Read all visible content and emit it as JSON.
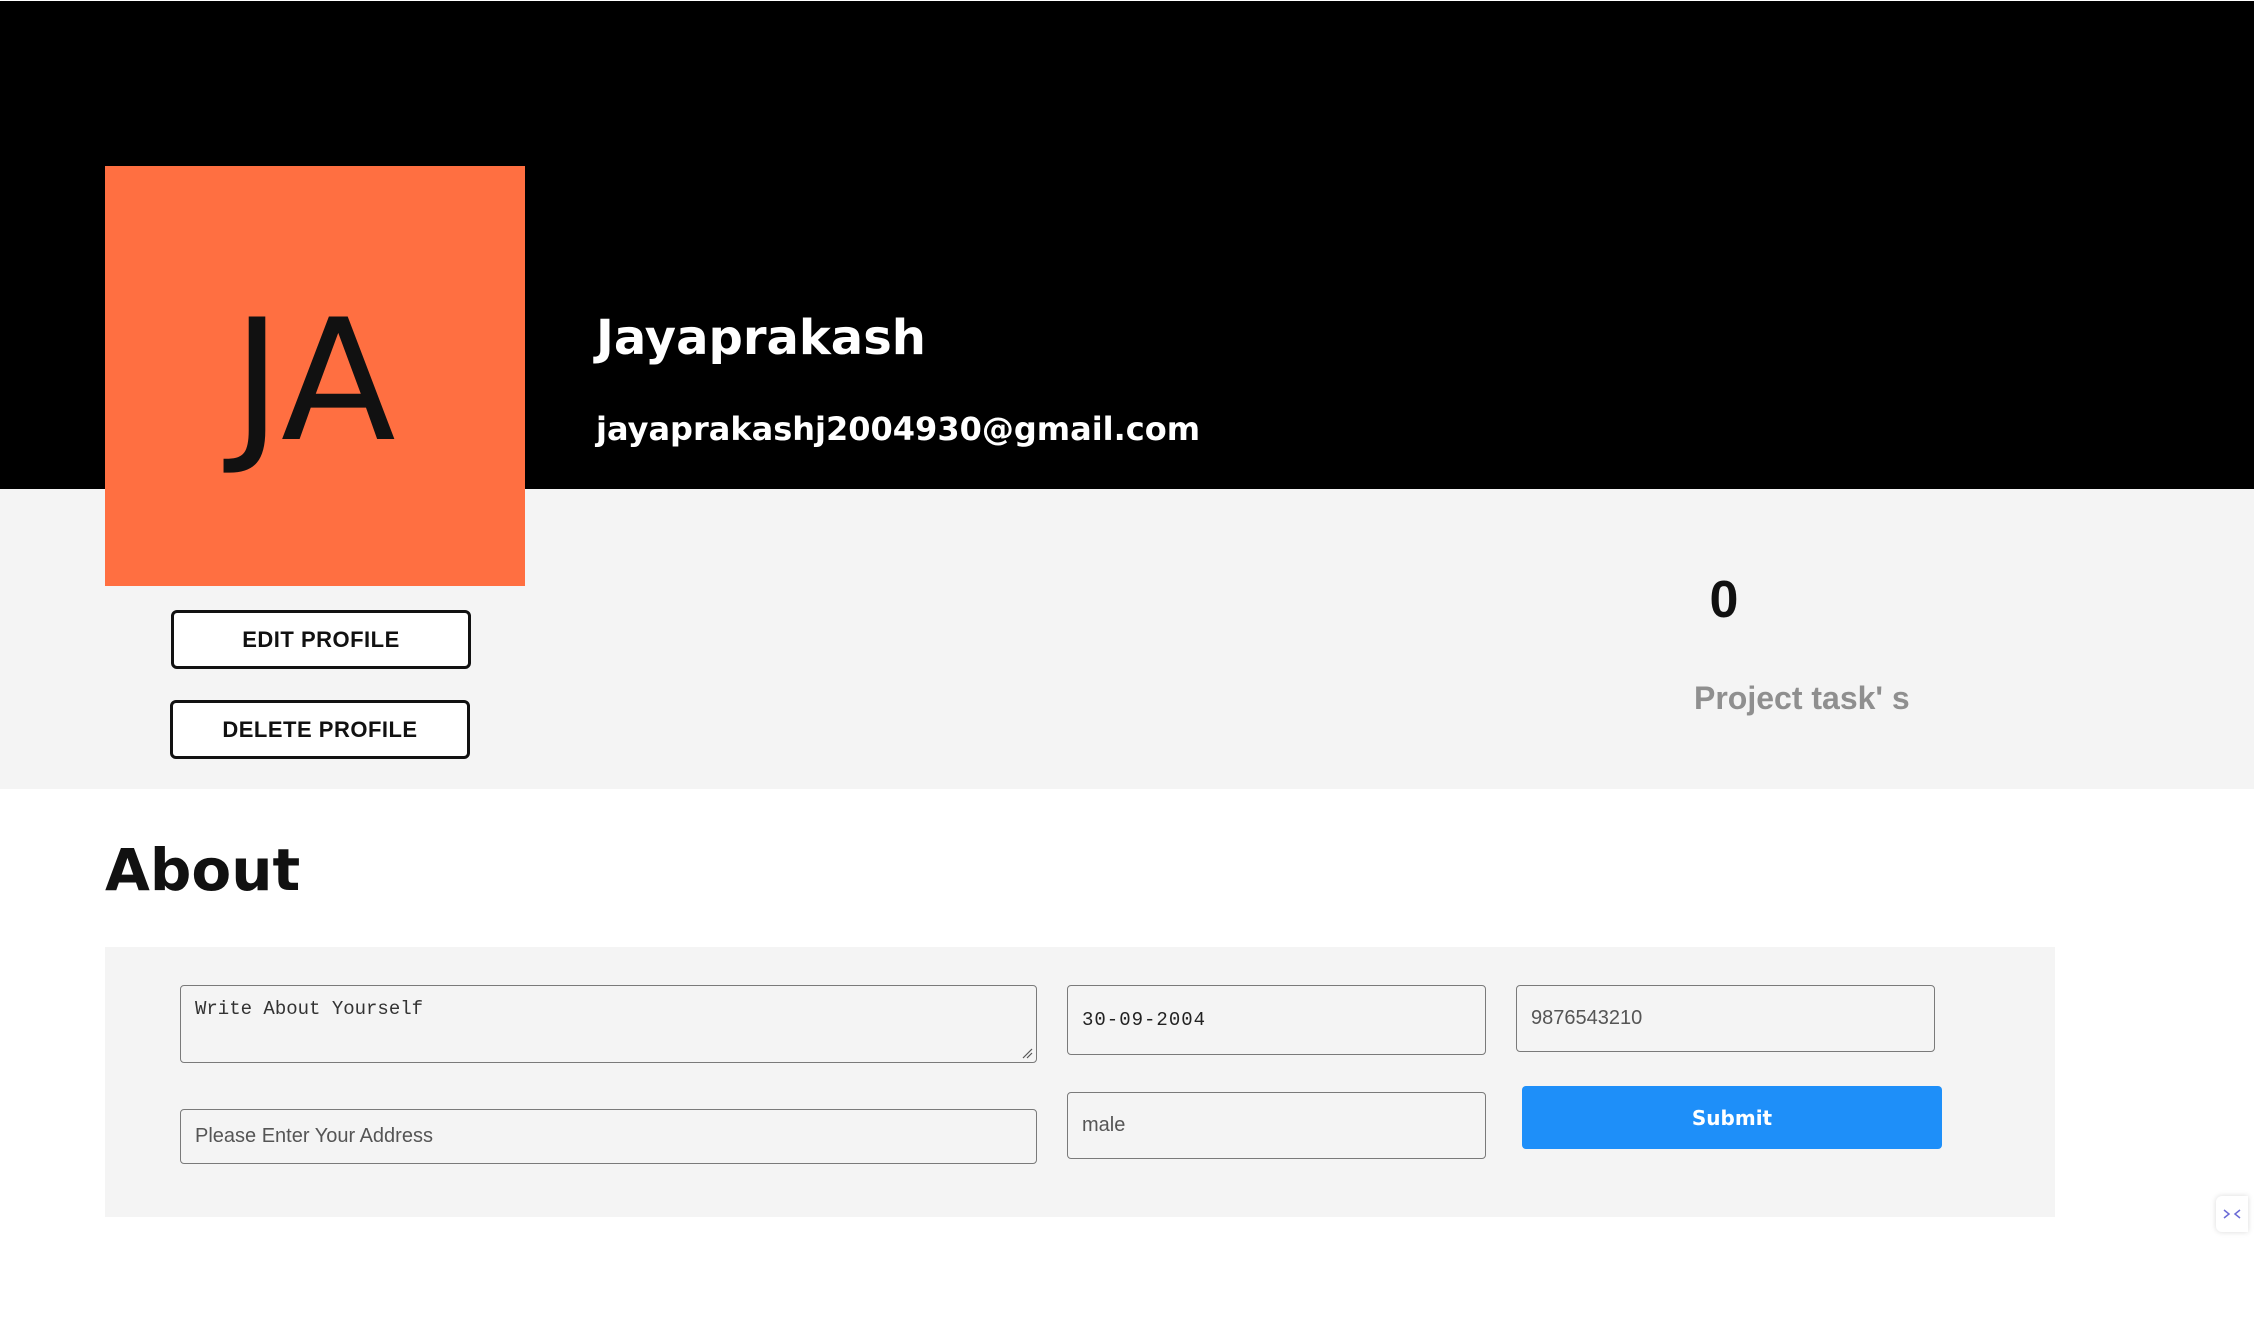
{
  "profile": {
    "initials": "JA",
    "name": "Jayaprakash",
    "email": "jayaprakashj2004930@gmail.com",
    "edit_label": "EDIT PROFILE",
    "delete_label": "DELETE PROFILE"
  },
  "stats": {
    "count": "0",
    "label": "Project task' s"
  },
  "about": {
    "title": "About",
    "about_placeholder": "Write About Yourself",
    "dob_value": "30-09-2004",
    "phone_value": "9876543210",
    "address_placeholder": "Please Enter Your Address",
    "gender_value": "male",
    "submit_label": "Submit"
  },
  "colors": {
    "header_bg": "#000000",
    "avatar_bg": "#ff6f41",
    "band_bg": "#f4f4f4",
    "submit_bg": "#1e8ff9"
  },
  "icons": {
    "corner_widget": "expand-arrows-icon",
    "textarea_grip": "resize-grip-icon"
  }
}
